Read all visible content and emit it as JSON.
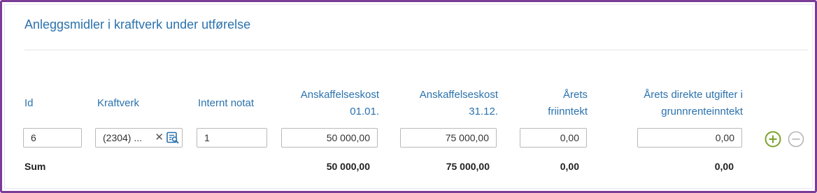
{
  "panel": {
    "title": "Anleggsmidler i kraftverk under utførelse"
  },
  "columns": {
    "id": "Id",
    "kraftverk": "Kraftverk",
    "internt_notat": "Internt notat",
    "anskaffelseskost_0101_line1": "Anskaffelseskost",
    "anskaffelseskost_0101_line2": "01.01.",
    "anskaffelseskost_3112_line1": "Anskaffelseskost",
    "anskaffelseskost_3112_line2": "31.12.",
    "friinntekt_line1": "Årets",
    "friinntekt_line2": "friinntekt",
    "direkte_utgifter_line1": "Årets direkte utgifter i",
    "direkte_utgifter_line2": "grunnrenteinntekt"
  },
  "row": {
    "id": "6",
    "kraftverk": "(2304) ...",
    "internt_notat": "1",
    "anskaffelseskost_0101": "50 000,00",
    "anskaffelseskost_3112": "75 000,00",
    "friinntekt": "0,00",
    "direkte_utgifter": "0,00"
  },
  "sum": {
    "label": "Sum",
    "anskaffelseskost_0101": "50 000,00",
    "anskaffelseskost_3112": "75 000,00",
    "friinntekt": "0,00",
    "direkte_utgifter": "0,00"
  },
  "colors": {
    "accent_blue": "#2b72ad",
    "frame_purple": "#7b3c97",
    "add_green": "#7aa32b",
    "remove_grey": "#b5b5b5"
  },
  "icons": {
    "clear": "close-icon",
    "lookup": "search-list-icon",
    "add": "plus-circle-icon",
    "remove": "minus-circle-icon"
  }
}
